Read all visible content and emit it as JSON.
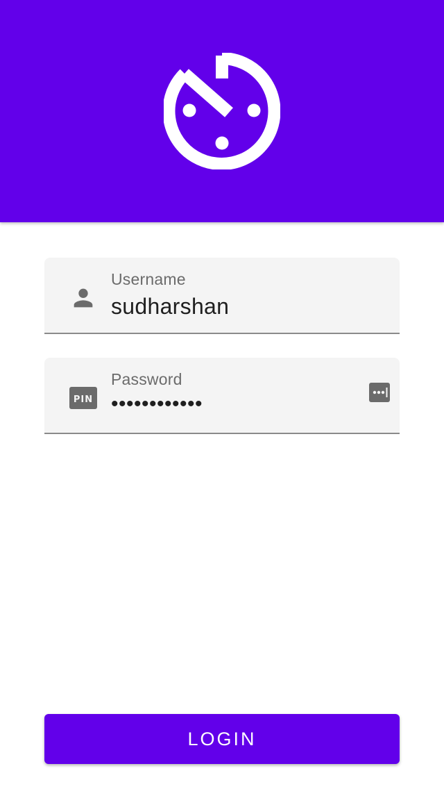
{
  "header": {
    "logo_icon": "timer-outline-icon",
    "background_color": "#6200ea"
  },
  "form": {
    "username": {
      "label": "Username",
      "value": "sudharshan",
      "icon": "person-icon"
    },
    "password": {
      "label": "Password",
      "value": "••••••••••••",
      "icon": "pin-icon",
      "trailing_icon": "password-dots-icon"
    }
  },
  "actions": {
    "login_label": "LOGIN",
    "accent_color": "#6200ea"
  }
}
